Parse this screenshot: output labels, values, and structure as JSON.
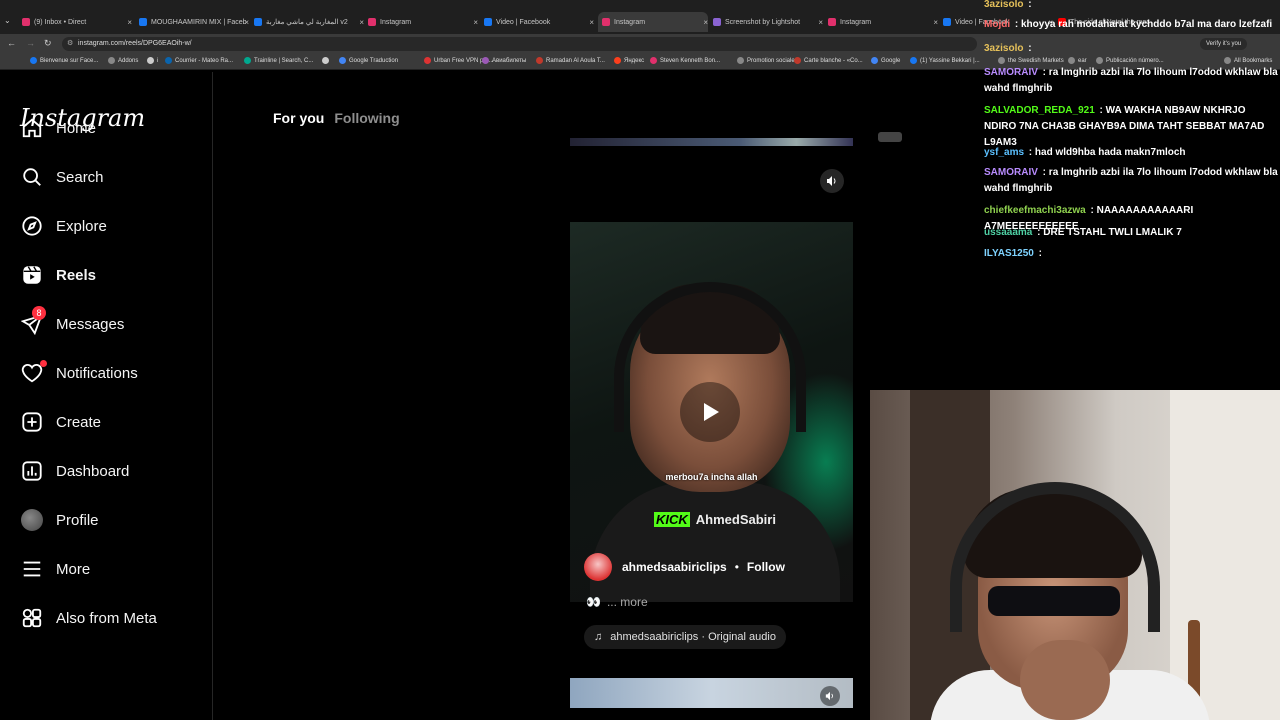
{
  "browser": {
    "tabs": [
      {
        "label": "(9) Inbox • Direct",
        "color": "#e1306c"
      },
      {
        "label": "MOUGHAAMIRIN MIX | Faceb",
        "color": "#1877f2"
      },
      {
        "label": "المغاربة لي ماشي مغاربة v2",
        "color": "#1877f2"
      },
      {
        "label": "Instagram",
        "color": "#e1306c"
      },
      {
        "label": "Video | Facebook",
        "color": "#1877f2"
      },
      {
        "label": "Instagram",
        "color": "#e1306c"
      },
      {
        "label": "Screenshot by Lightshot",
        "color": "#8a63d2"
      },
      {
        "label": "Instagram",
        "color": "#e1306c"
      },
      {
        "label": "Video | Facebook",
        "color": "#1877f2"
      },
      {
        "label": "The side of Natal the media",
        "color": "#ff0000"
      }
    ],
    "url": "instagram.com/reels/DPG6EAOih-w/",
    "verify_chip": "Verify it's you",
    "bookmarks": [
      {
        "label": "Bienvenue sur Face...",
        "color": "#1877f2"
      },
      {
        "label": "Addons",
        "color": "#888888"
      },
      {
        "label": "i",
        "color": "#cccccc"
      },
      {
        "label": "Courrier - Mateo Ra...",
        "color": "#0a64ad"
      },
      {
        "label": "Trainline | Search, C...",
        "color": "#00a88f"
      },
      {
        "label": "",
        "color": "#cccccc"
      },
      {
        "label": "Google Traduction",
        "color": "#4285f4"
      },
      {
        "label": "Urban Free VPN pro...",
        "color": "#d33"
      },
      {
        "label": "Авиабилеты",
        "color": "#9b59b6"
      },
      {
        "label": "Ramadan Al Aoula T...",
        "color": "#c0392b"
      },
      {
        "label": "Яндекс",
        "color": "#fc3f1d"
      },
      {
        "label": "Steven Kenneth Bon...",
        "color": "#e1306c"
      },
      {
        "label": "Promotion sociale",
        "color": "#888888"
      },
      {
        "label": "Carte blanche - «Co...",
        "color": "#c0392b"
      },
      {
        "label": "Google",
        "color": "#4285f4"
      },
      {
        "label": "(1) Yassine Bekkari |...",
        "color": "#1877f2"
      },
      {
        "label": "the Swedish Markets",
        "color": "#888888"
      },
      {
        "label": "ear",
        "color": "#888888"
      },
      {
        "label": "Publicación número...",
        "color": "#888888"
      },
      {
        "label": "All Bookmarks",
        "color": "#888888"
      }
    ]
  },
  "sidebar": {
    "logo": "Instagram",
    "items": [
      {
        "label": "Home",
        "icon": "home-icon"
      },
      {
        "label": "Search",
        "icon": "search-icon"
      },
      {
        "label": "Explore",
        "icon": "compass-icon"
      },
      {
        "label": "Reels",
        "icon": "reels-icon"
      },
      {
        "label": "Messages",
        "icon": "messenger-icon",
        "badge": "8"
      },
      {
        "label": "Notifications",
        "icon": "heart-icon"
      },
      {
        "label": "Create",
        "icon": "plus-square-icon"
      },
      {
        "label": "Dashboard",
        "icon": "dashboard-icon"
      },
      {
        "label": "Profile",
        "icon": "profile-avatar"
      },
      {
        "label": "More",
        "icon": "menu-icon"
      },
      {
        "label": "Also from Meta",
        "icon": "meta-apps-icon"
      }
    ]
  },
  "feed": {
    "tabs": [
      "For you",
      "Following"
    ],
    "reel": {
      "caption_overlay": "merbou7a incha allah",
      "kick_logo": "KICK",
      "kick_name": "AhmedSabiri",
      "username": "ahmedsaabiriclips",
      "separator": "•",
      "follow_label": "Follow",
      "more_label": "... more",
      "audio": "ahmedsaabiriclips · Original audio"
    }
  },
  "chat": {
    "messages": [
      {
        "user": "3azisolo",
        "text": "",
        "color": "#e6c15a"
      },
      {
        "user": "Mojdi",
        "text": "khoyya rah modaharat kychddo b7al ma daro lzefzafi",
        "color": "#ff6b6b"
      },
      {
        "user": "3azisolo",
        "text": "",
        "color": "#e6c15a"
      },
      {
        "user": "SAMORAIV",
        "text": "ra lmghrib azbi ila 7lo lihoum l7odod wkhlaw bla wahd flmghrib",
        "color": "#b98cff"
      },
      {
        "user": "SALVADOR_REDA_921",
        "text": "WA WAKHA NB9AW NKHRJO NDIRO 7NA CHA3B GHAYB9A DIMA TAHT SEBBAT MA7AD L9AM3",
        "color": "#53fc18"
      },
      {
        "user": "ysf_ams",
        "text": "had wld9hba hada makn7mloch",
        "color": "#5bc0ff"
      },
      {
        "user": "SAMORAIV",
        "text": "ra lmghrib azbi ila 7lo lihoum l7odod wkhlaw bla wahd flmghrib",
        "color": "#b98cff"
      },
      {
        "user": "chiefkeefmachi3azwa",
        "text": "NAAAAAAAAAAARI A7MEEEEEEEEEEE",
        "color": "#8fd14f"
      },
      {
        "user": "ussaaama",
        "text": "DRE TSTAHL TWLI LMALIK 7",
        "color": "#4fd1a5"
      },
      {
        "user": "ILYAS1250",
        "text": "",
        "color": "#7fd3ff"
      }
    ]
  }
}
